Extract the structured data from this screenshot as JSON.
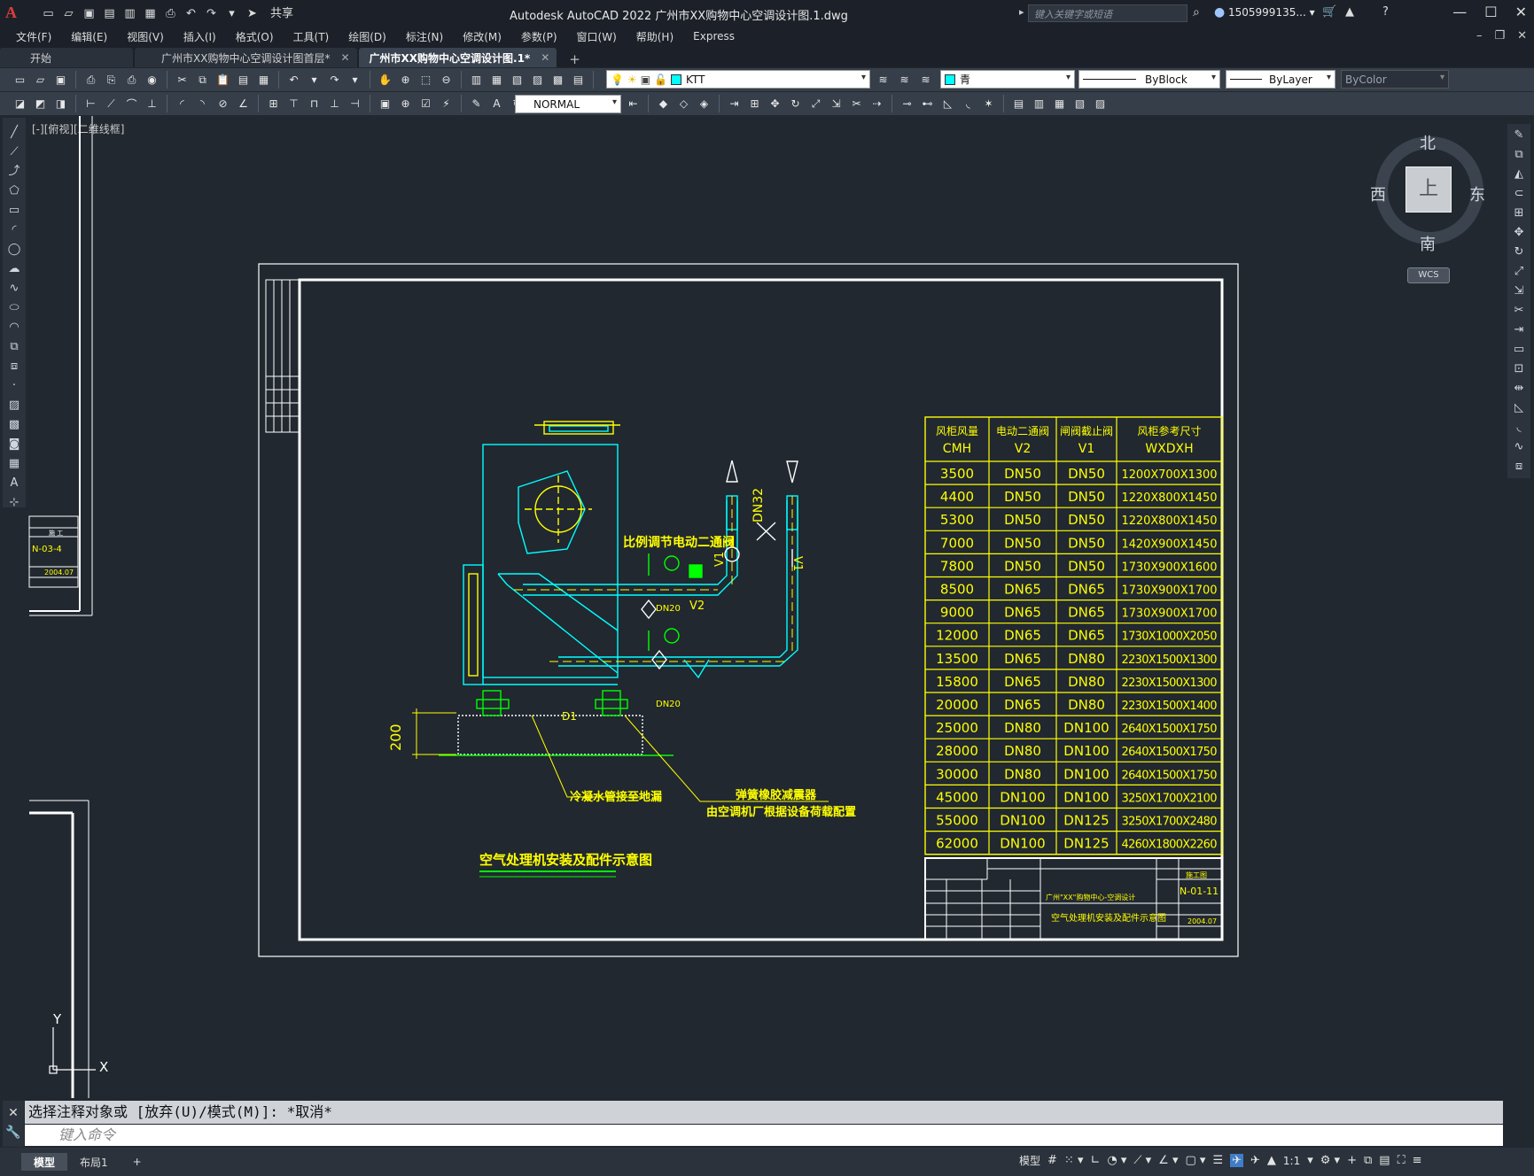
{
  "window": {
    "title": "Autodesk AutoCAD 2022    广州市XX购物中心空调设计图.1.dwg",
    "search_placeholder": "键入关键字或短语",
    "user": "1505999135... ▾",
    "share": "共享",
    "app_letter": "A"
  },
  "menu": [
    "文件(F)",
    "编辑(E)",
    "视图(V)",
    "插入(I)",
    "格式(O)",
    "工具(T)",
    "绘图(D)",
    "标注(N)",
    "修改(M)",
    "参数(P)",
    "窗口(W)",
    "帮助(H)",
    "Express"
  ],
  "tabs": [
    {
      "label": "开始",
      "active": false
    },
    {
      "label": "广州市XX购物中心空调设计图首层*",
      "active": false
    },
    {
      "label": "广州市XX购物中心空调设计图.1*",
      "active": true
    }
  ],
  "toolbar": {
    "layer": "KTT",
    "color": "青",
    "linetype": "ByBlock",
    "lineweight": "ByLayer",
    "plotstyle": "ByColor",
    "style": "NORMAL"
  },
  "viewport_label": "[-][俯视][二维线框]",
  "viewcube": {
    "north": "北",
    "south": "南",
    "east": "东",
    "west": "西",
    "top": "上",
    "wcs": "WCS"
  },
  "drawing": {
    "title": "空气处理机安装及配件示意图",
    "notes": {
      "valve": "比例调节电动二通阀",
      "drain": "冷凝水管接至地漏",
      "spring": "弹簧橡胶减震器",
      "spring2": "由空调机厂根据设备荷载配置",
      "dim200": "200",
      "dn32": "DN32",
      "dn20a": "DN20",
      "dn20b": "DN20",
      "v1a": "V1",
      "v1b": "V1",
      "v2": "V2",
      "d1": "D1"
    },
    "table_headers": [
      [
        "风柜风量",
        "CMH"
      ],
      [
        "电动二通阀",
        "V2"
      ],
      [
        "闸阀截止阀",
        "V1"
      ],
      [
        "风柜参考尺寸",
        "WXDXH"
      ]
    ],
    "table_rows": [
      [
        "3500",
        "DN50",
        "DN50",
        "1200X700X1300"
      ],
      [
        "4400",
        "DN50",
        "DN50",
        "1220X800X1450"
      ],
      [
        "5300",
        "DN50",
        "DN50",
        "1220X800X1450"
      ],
      [
        "7000",
        "DN50",
        "DN50",
        "1420X900X1450"
      ],
      [
        "7800",
        "DN50",
        "DN50",
        "1730X900X1600"
      ],
      [
        "8500",
        "DN65",
        "DN65",
        "1730X900X1700"
      ],
      [
        "9000",
        "DN65",
        "DN65",
        "1730X900X1700"
      ],
      [
        "12000",
        "DN65",
        "DN65",
        "1730X1000X2050"
      ],
      [
        "13500",
        "DN65",
        "DN80",
        "2230X1500X1300"
      ],
      [
        "15800",
        "DN65",
        "DN80",
        "2230X1500X1300"
      ],
      [
        "20000",
        "DN65",
        "DN80",
        "2230X1500X1400"
      ],
      [
        "25000",
        "DN80",
        "DN100",
        "2640X1500X1750"
      ],
      [
        "28000",
        "DN80",
        "DN100",
        "2640X1500X1750"
      ],
      [
        "30000",
        "DN80",
        "DN100",
        "2640X1500X1750"
      ],
      [
        "45000",
        "DN100",
        "DN100",
        "3250X1700X2100"
      ],
      [
        "55000",
        "DN100",
        "DN125",
        "3250X1700X2480"
      ],
      [
        "62000",
        "DN100",
        "DN125",
        "4260X1800X2260"
      ]
    ],
    "titleblock": {
      "project": "广州\"XX\"购物中心-空调设计",
      "drawing_name": "空气处理机安装及配件示意图",
      "drawing_no": "N-01-11",
      "stage": "施工图",
      "date": "2004.07",
      "left_no": "N-03-4",
      "left_date": "2004.07",
      "left_stage": "施 工"
    }
  },
  "command": {
    "history": "选择注释对象或 [放弃(U)/模式(M)]: *取消*",
    "placeholder": "键入命令"
  },
  "layout_tabs": [
    "模型",
    "布局1"
  ],
  "status": {
    "scale": "1:1",
    "model_label": "模型"
  }
}
